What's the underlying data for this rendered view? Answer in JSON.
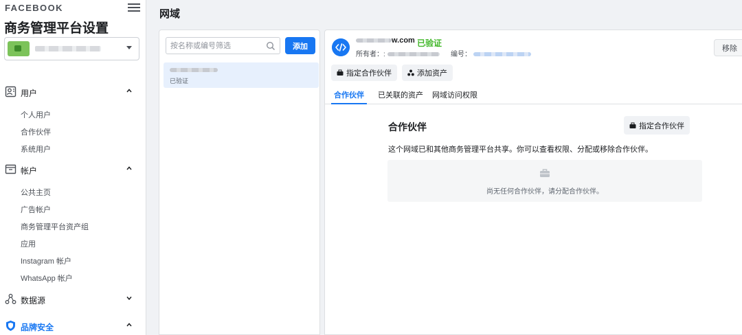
{
  "sidebar": {
    "brand": "FACEBOOK",
    "title": "商务管理平台设置",
    "account_name": "·",
    "sections": [
      {
        "label": "用户",
        "icon": "users-icon",
        "expanded": true,
        "items": [
          "个人用户",
          "合作伙伴",
          "系统用户"
        ]
      },
      {
        "label": "帐户",
        "icon": "accounts-icon",
        "expanded": true,
        "items": [
          "公共主页",
          "广告帐户",
          "商务管理平台资产组",
          "应用",
          "Instagram 帐户",
          "WhatsApp 帐户"
        ]
      },
      {
        "label": "数据源",
        "icon": "data-sources-icon",
        "expanded": false,
        "items": []
      },
      {
        "label": "品牌安全",
        "icon": "shield-icon",
        "expanded": true,
        "active": true,
        "items": []
      }
    ]
  },
  "page": {
    "title": "网域"
  },
  "list": {
    "search_placeholder": "按名称或编号筛选",
    "add_label": "添加",
    "items": [
      {
        "status": "已验证"
      }
    ]
  },
  "detail": {
    "domain_suffix": "w.com",
    "verified_label": "已验证",
    "owner_label": "所有者：:",
    "id_label": "编号：",
    "remove_label": "移除",
    "assign_partner_label": "指定合作伙伴",
    "add_asset_label": "添加资产",
    "tabs": [
      "合作伙伴",
      "已关联的资产",
      "网域访问权限"
    ],
    "active_tab": 0,
    "partners": {
      "heading": "合作伙伴",
      "assign_label": "指定合作伙伴",
      "description": "这个网域已和其他商务管理平台共享。你可以查看权限、分配或移除合作伙伴。",
      "empty_text": "尚无任何合作伙伴，请分配合作伙伴。"
    }
  },
  "colors": {
    "accent": "#1877f2",
    "verified": "#42b72a",
    "active_item_bg": "#e7f0fd"
  }
}
